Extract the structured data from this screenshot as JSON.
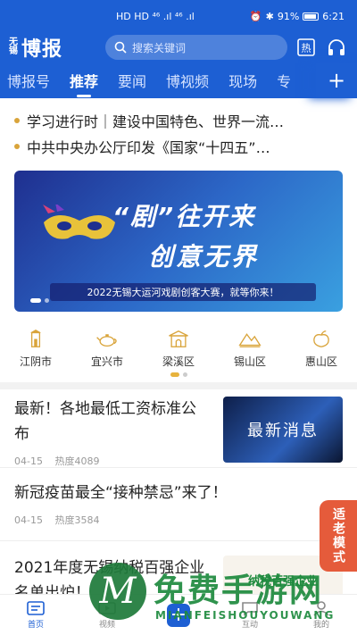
{
  "status_bar": {
    "left": "HD HD ⁴⁶ .ıl ⁴⁶ .ıl",
    "battery": "91%",
    "time": "6:21"
  },
  "header": {
    "logo_small": "无锡",
    "logo_big": "博报",
    "search_placeholder": "搜索关键词"
  },
  "tabs": [
    {
      "label": "博报号"
    },
    {
      "label": "推荐"
    },
    {
      "label": "要闻"
    },
    {
      "label": "博视频"
    },
    {
      "label": "现场"
    },
    {
      "label": "专"
    }
  ],
  "headlines": [
    "学习进行时｜建设中国特色、世界一流…",
    "中共中央办公厅印发《国家“十四五”…"
  ],
  "banner": {
    "title_line1": "“剧”往开来",
    "title_line2": "创意无界",
    "caption": "2022无锡大运河戏剧创客大赛，就等你来！"
  },
  "regions": [
    {
      "label": "江阴市",
      "icon": "tower-icon"
    },
    {
      "label": "宜兴市",
      "icon": "teapot-icon"
    },
    {
      "label": "梁溪区",
      "icon": "gate-icon"
    },
    {
      "label": "锡山区",
      "icon": "mountain-icon"
    },
    {
      "label": "惠山区",
      "icon": "peach-icon"
    }
  ],
  "news": [
    {
      "title": "最新！各地最低工资标准公布",
      "date": "04-15",
      "heat": "热度4089",
      "thumb_text": "最新消息"
    },
    {
      "title": "新冠疫苗最全“接种禁忌”来了！",
      "date": "04-15",
      "heat": "热度3584"
    },
    {
      "title": "2021年度无锡纳税百强企业名单出炉！",
      "thumb_text": "纳税百强企业"
    }
  ],
  "elder_mode": "适老模式",
  "bottom_nav": [
    {
      "label": "首页",
      "icon": "home-icon"
    },
    {
      "label": "视频",
      "icon": "video-icon"
    },
    {
      "label": "",
      "icon": "plus-icon"
    },
    {
      "label": "互动",
      "icon": "chat-icon"
    },
    {
      "label": "我的",
      "icon": "user-icon"
    }
  ],
  "watermark": {
    "logo_letter": "M",
    "text": "免费手游网",
    "sub": "MIANFEISHOUYOUWANG"
  },
  "colors": {
    "brand": "#1d5fd3",
    "accent_gold": "#d9a43a",
    "elder_red": "#e55b3b"
  }
}
